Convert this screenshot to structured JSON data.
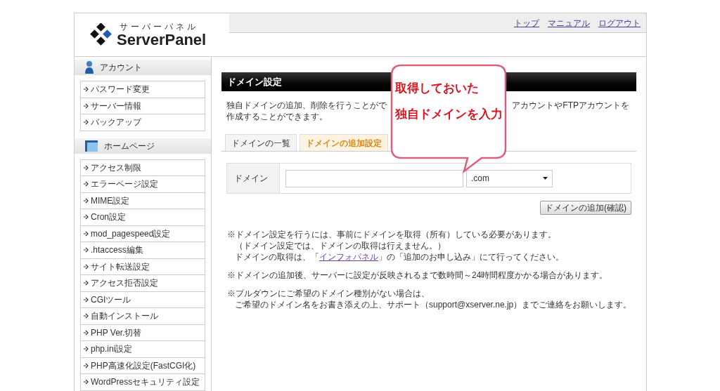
{
  "logo": {
    "kana": "サーバーパネル",
    "name": "ServerPanel"
  },
  "top_links": [
    "トップ",
    "マニュアル",
    "ログアウト"
  ],
  "sidebar": [
    {
      "title": "アカウント",
      "kind": "person",
      "items": [
        "パスワード変更",
        "サーバー情報",
        "バックアップ"
      ]
    },
    {
      "title": "ホームページ",
      "kind": "page",
      "items": [
        "アクセス制限",
        "エラーページ設定",
        "MIME設定",
        "Cron設定",
        "mod_pagespeed設定",
        ".htaccess編集",
        "サイト転送設定",
        "アクセス拒否設定",
        "CGIツール",
        "自動インストール",
        "PHP Ver.切替",
        "php.ini設定",
        "PHP高速化設定(FastCGI化)",
        "WordPressセキュリティ設定"
      ]
    }
  ],
  "main": {
    "title": "ドメイン設定",
    "description": {
      "line1_start": "独自ドメインの追加、削除を行うことがで",
      "line1_end": "アカウントやFTPアカウントを",
      "line2": "作成することができます。"
    },
    "tabs": [
      {
        "label": "ドメインの一覧",
        "selected": false
      },
      {
        "label": "ドメインの追加設定",
        "selected": true
      }
    ],
    "form": {
      "label": "ドメイン",
      "select_value": ".com"
    },
    "submit_button": "ドメインの追加(確認)",
    "notes": [
      {
        "lines": [
          {
            "text": "※ドメイン設定を行うには、事前にドメインを取得（所有）している必要があります。"
          },
          {
            "text": "（ドメイン設定では、ドメインの取得は行えません。）"
          },
          {
            "text": "ドメインの取得は、「",
            "link": "インフォパネル",
            "after": "」の「追加のお申し込み」にて行ってください。"
          }
        ]
      },
      {
        "lines": [
          {
            "text": "※ドメインの追加後、サーバーに設定が反映されるまで数時間～24時間程度かかる場合があります。"
          }
        ]
      },
      {
        "lines": [
          {
            "text": "※プルダウンにご希望のドメイン種別がない場合は、"
          },
          {
            "text": "ご希望のドメイン名をお書き添えの上、サポート（support@xserver.ne.jp）までご連絡をお願いします。"
          }
        ]
      }
    ]
  },
  "callout": {
    "lines": [
      "取得しておいた",
      "独自ドメインを入力"
    ]
  }
}
